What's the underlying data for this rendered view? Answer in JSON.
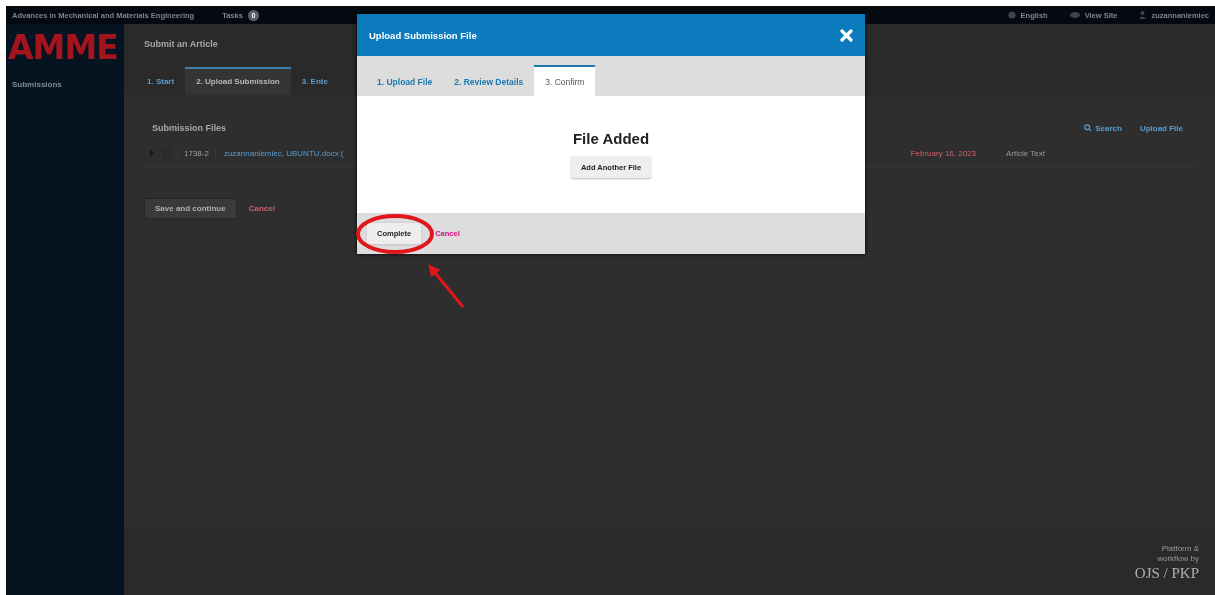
{
  "top_bar": {
    "site_title": "Advances in Mechanical and Materials Engineering",
    "tasks": {
      "label": "Tasks",
      "count": "0"
    },
    "links": [
      {
        "kind": "language",
        "label": "English"
      },
      {
        "kind": "view",
        "label": "View Site"
      },
      {
        "kind": "user",
        "label": "zuzannaniemiec"
      }
    ]
  },
  "sidebar": {
    "logo": "AMME",
    "items": [
      {
        "label": "Submissions",
        "selected": false
      }
    ]
  },
  "page": {
    "title": "Submit an Article",
    "tabs": [
      {
        "label": "1. Start",
        "selected": false
      },
      {
        "label": "2. Upload Submission",
        "selected": true
      },
      {
        "label": "3. Ente",
        "selected": false
      }
    ]
  },
  "submission_files": {
    "title": "Submission Files",
    "actions": [
      {
        "kind": "search",
        "label": "Search"
      },
      {
        "kind": "upload",
        "label": "Upload File"
      }
    ],
    "rows": [
      {
        "id": "1738-2",
        "name": "zuzannaniemiec, UBUNTU.docx (",
        "date": "February 16, 2023",
        "type": "Article Text"
      }
    ]
  },
  "buttons": [
    {
      "kind": "primary",
      "label": "Save and continue"
    },
    {
      "kind": "cancel",
      "label": "Cancel"
    }
  ],
  "footer": {
    "lines": [
      "Platform &",
      "workflow by"
    ],
    "logo": "OJS / PKP"
  },
  "modal": {
    "title": "Upload Submission File",
    "tabs": [
      {
        "label": "1. Upload File",
        "selected": false
      },
      {
        "label": "2. Review Details",
        "selected": false
      },
      {
        "label": "3. Confirm",
        "selected": true
      }
    ],
    "heading": "File Added",
    "body_button": "Add Another File",
    "footer_buttons": [
      {
        "kind": "primary",
        "label": "Complete"
      },
      {
        "kind": "cancel",
        "label": "Cancel"
      }
    ]
  }
}
